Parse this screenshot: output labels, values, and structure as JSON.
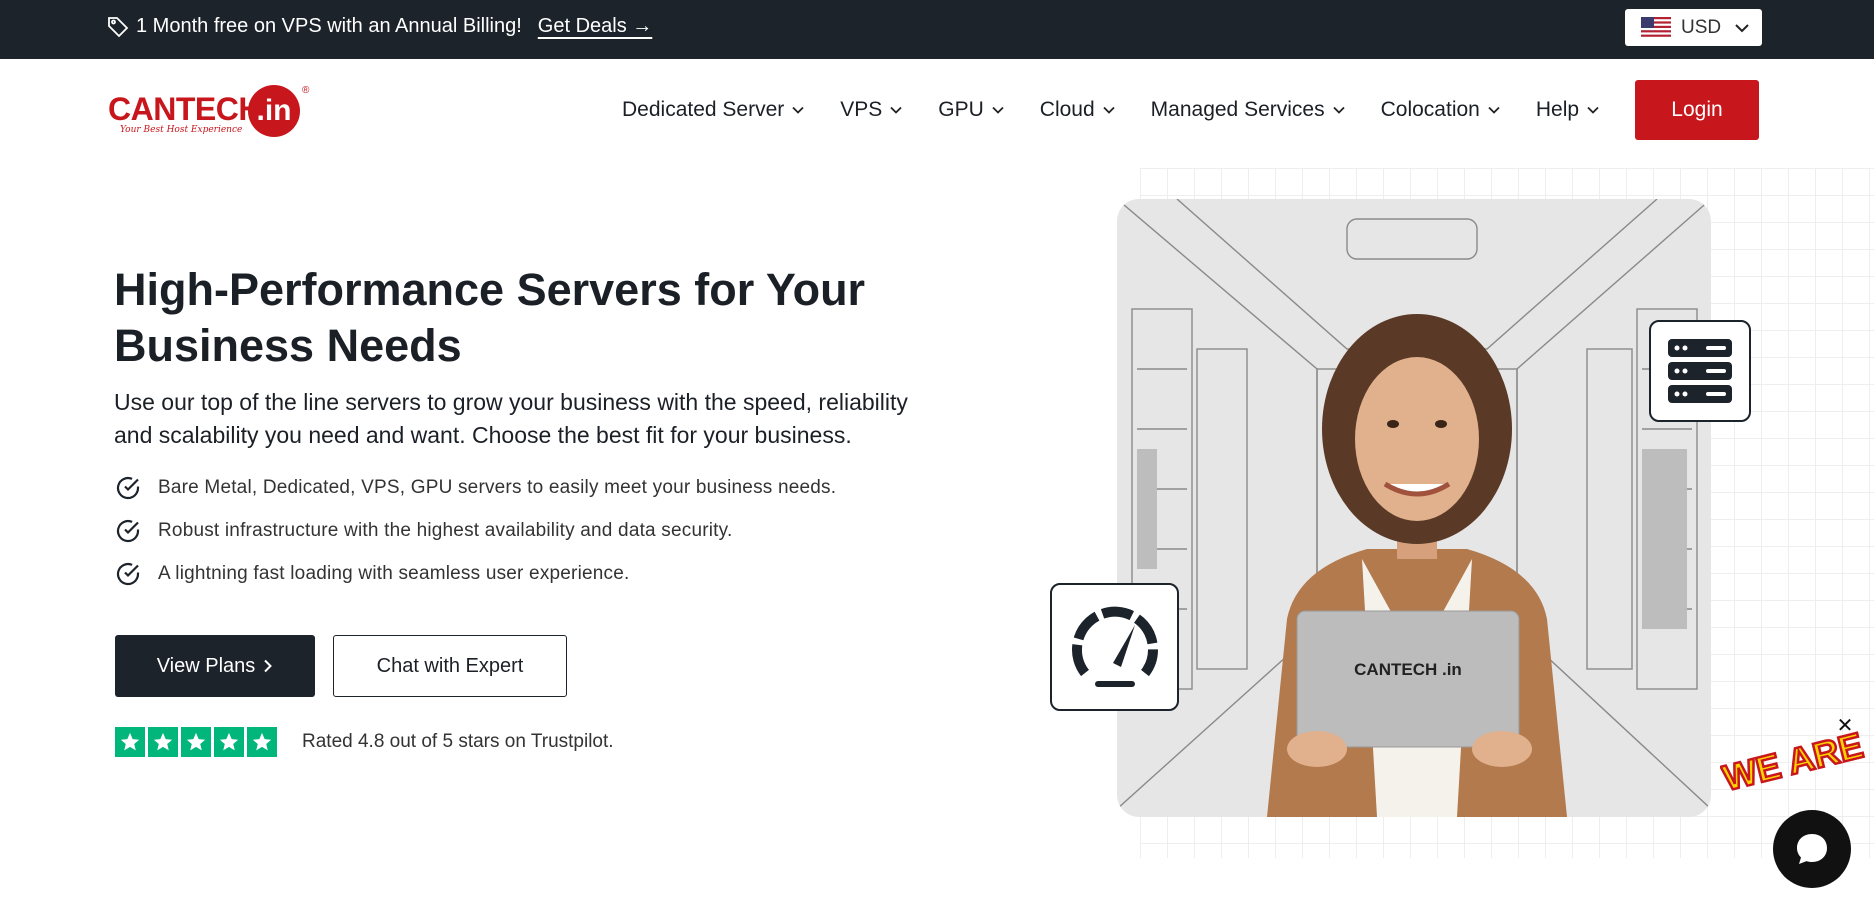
{
  "topbar": {
    "promo_text": "1 Month free on VPS with an Annual Billing!",
    "deal_link": "Get Deals →",
    "currency": "USD"
  },
  "brand": {
    "logo_text": "CANTECH",
    "logo_suffix": ".in",
    "logo_reg": "®",
    "tagline": "Your Best Host Experience",
    "color": "#c8161d"
  },
  "nav": {
    "items": [
      {
        "label": "Dedicated Server"
      },
      {
        "label": "VPS"
      },
      {
        "label": "GPU"
      },
      {
        "label": "Cloud"
      },
      {
        "label": "Managed Services"
      },
      {
        "label": "Colocation"
      },
      {
        "label": "Help"
      }
    ],
    "login_label": "Login"
  },
  "hero": {
    "title_line1": "High-Performance Servers for Your",
    "title_line2": "Business Needs",
    "subtitle_line1": "Use our top of the line servers to grow your business with the speed, reliability",
    "subtitle_line2": "and scalability you need and want. Choose the best fit for your business.",
    "bullets": [
      "Bare Metal, Dedicated, VPS, GPU servers to easily meet your business needs.",
      "Robust infrastructure with the highest availability and data security.",
      "A lightning fast loading with seamless user experience."
    ],
    "primary_button": "View Plans",
    "secondary_button": "Chat with Expert",
    "rating_stars": 5,
    "rating_text": "Rated 4.8 out of 5 stars on Trustpilot.",
    "laptop_logo": "CANTECH .in"
  },
  "chat_widget": {
    "close_label": "✕",
    "banner_text": "WE ARE HERE",
    "icon": "chat-bubble-icon"
  },
  "colors": {
    "dark": "#1c232b",
    "accent_red": "#c8161d",
    "trustpilot_green": "#00b67a"
  }
}
